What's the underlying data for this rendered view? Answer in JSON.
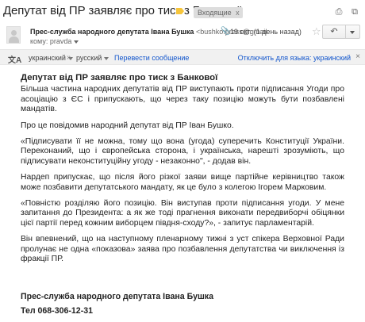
{
  "header": {
    "subject": "Депутат від ПР заявляє про тиск з Банкової",
    "inbox_label": "Входящие",
    "inbox_close": "x",
    "icons": [
      "print-icon",
      "new-window-icon"
    ]
  },
  "message": {
    "sender_name": "Прес-служба народного депутата Івана Бушка",
    "sender_email": "<bushko.press@gmail",
    "to_line": "кому: pravda",
    "date": "19 окт. (1 день назад)",
    "reply_icon": "↶"
  },
  "translate": {
    "from_lang": "украинский",
    "to_lang": "русский",
    "translate_link": "Перевести сообщение",
    "disable_link": "Отключить для языка: украинский",
    "close": "×"
  },
  "body": {
    "title": "Депутат від ПР заявляє про тиск з Банкової",
    "paragraphs": [
      "Більша частина народних депутатів від ПР виступають проти підписання Угоди про асоціацію з ЄС і припускають, що через таку позицію можуть бути позбавлені мандатів.",
      "Про це повідомив народний депутат  від ПР Іван Бушко.",
      "«Підписувати її не можна, тому що вона (угода) суперечить Конституції України. Переконаний, що і європейська сторона, і українська, нарешті зрозуміють, що підписувати неконституційну угоду - незаконно\", - додав він.",
      "Нардеп припускає, що після його різкої заяви вище партійне керівництво також може позбавити депутатського мандату, як це було з колегою Ігорем Марковим.",
      "«Повністю розділяю його позицію. Він виступав проти підписання угоди. У мене запитання до Президента: а як же тоді прагнення виконати передвиборчі обіцянки цієї партії перед кожним виборцем півдня-сходу?»,  - запитує парламентарій.",
      "Він впевнений, що на наступному пленарному тижні з уст спікера Верховної Ради пролунає не одна «показова» заява про позбавлення депутатства чи виключення із фракції ПР."
    ],
    "signature_name": "Прес-служба народного депутата Івана Бушка",
    "signature_phone": "Тел 068-306-12-31"
  }
}
